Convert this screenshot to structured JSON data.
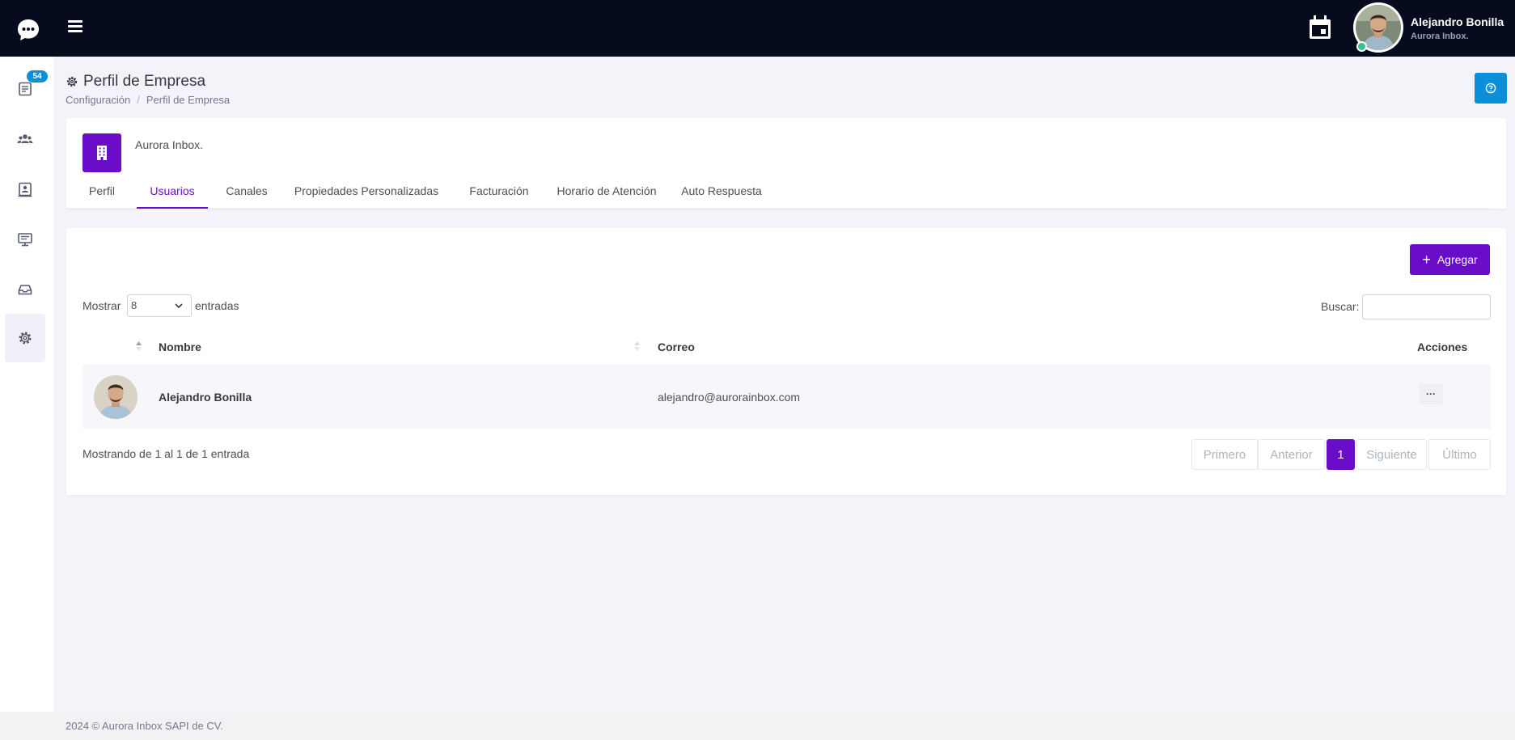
{
  "topbar": {
    "logo_icon": "chat-bubble-icon",
    "menu_icon": "hamburger-icon",
    "calendar_icon": "calendar-icon",
    "user_name": "Alejandro Bonilla",
    "user_org": "Aurora Inbox.",
    "status_color": "#34c38f"
  },
  "sidebar": {
    "badge": "54",
    "items": [
      {
        "icon": "conversations-icon"
      },
      {
        "icon": "users-group-icon"
      },
      {
        "icon": "contacts-icon"
      },
      {
        "icon": "monitor-icon"
      },
      {
        "icon": "inbox-icon"
      },
      {
        "icon": "gear-icon",
        "active": true
      }
    ]
  },
  "page": {
    "title": "Perfil de Empresa",
    "breadcrumb": [
      "Configuración",
      "Perfil de Empresa"
    ],
    "help_icon": "help-circle-icon"
  },
  "company": {
    "name": "Aurora Inbox.",
    "icon": "building-icon",
    "accent": "#6a0dc9",
    "tabs": [
      {
        "label": "Perfil"
      },
      {
        "label": "Usuarios",
        "active": true
      },
      {
        "label": "Canales"
      },
      {
        "label": "Propiedades Personalizadas"
      },
      {
        "label": "Facturación"
      },
      {
        "label": "Horario de Atención"
      },
      {
        "label": "Auto Respuesta"
      }
    ]
  },
  "users": {
    "add_label": "Agregar",
    "show_label": "Mostrar",
    "page_size": "8",
    "entries_label": "entradas",
    "search_label": "Buscar:",
    "search_value": "",
    "columns": {
      "name": "Nombre",
      "email": "Correo",
      "actions": "Acciones"
    },
    "rows": [
      {
        "name": "Alejandro Bonilla",
        "email": "alejandro@aurorainbox.com",
        "actions": "···"
      }
    ],
    "info": "Mostrando de 1 al 1 de 1 entrada",
    "pagination": {
      "first": "Primero",
      "prev": "Anterior",
      "current": "1",
      "next": "Siguiente",
      "last": "Último"
    }
  },
  "footer": {
    "text": "2024 © Aurora Inbox SAPI de CV."
  }
}
